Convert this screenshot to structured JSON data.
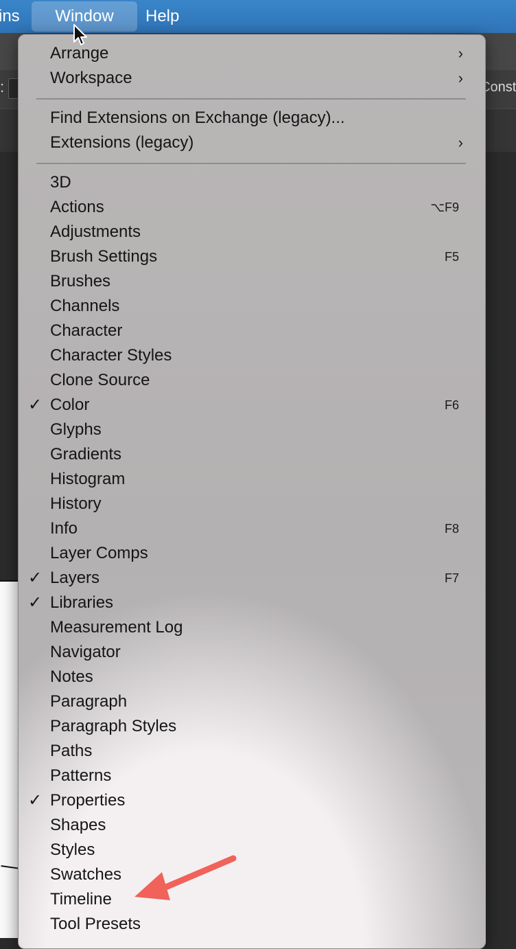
{
  "menubar": {
    "plugins_label": "ins",
    "window_label": "Window",
    "help_label": "Help"
  },
  "app": {
    "colon": ":",
    "const_label": "Const"
  },
  "menu": {
    "arrange": "Arrange",
    "workspace": "Workspace",
    "find_extensions": "Find Extensions on Exchange (legacy)...",
    "extensions": "Extensions (legacy)",
    "chevron": "›",
    "check": "✓",
    "items": {
      "3d": "3D",
      "actions": "Actions",
      "actions_shortcut": "⌥F9",
      "adjustments": "Adjustments",
      "brush_settings": "Brush Settings",
      "brush_settings_shortcut": "F5",
      "brushes": "Brushes",
      "channels": "Channels",
      "character": "Character",
      "character_styles": "Character Styles",
      "clone_source": "Clone Source",
      "color": "Color",
      "color_shortcut": "F6",
      "glyphs": "Glyphs",
      "gradients": "Gradients",
      "histogram": "Histogram",
      "history": "History",
      "info": "Info",
      "info_shortcut": "F8",
      "layer_comps": "Layer Comps",
      "layers": "Layers",
      "layers_shortcut": "F7",
      "libraries": "Libraries",
      "measurement_log": "Measurement Log",
      "navigator": "Navigator",
      "notes": "Notes",
      "paragraph": "Paragraph",
      "paragraph_styles": "Paragraph Styles",
      "paths": "Paths",
      "patterns": "Patterns",
      "properties": "Properties",
      "shapes": "Shapes",
      "styles": "Styles",
      "swatches": "Swatches",
      "timeline": "Timeline",
      "tool_presets": "Tool Presets"
    }
  },
  "colors": {
    "menubar": "#3a85c9",
    "annotation_arrow": "#f0625a"
  }
}
